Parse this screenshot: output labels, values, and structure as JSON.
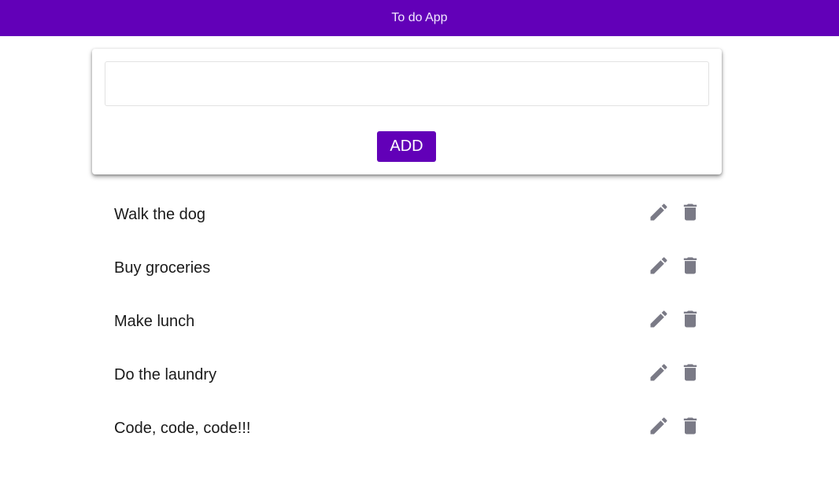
{
  "app": {
    "title": "To do App"
  },
  "form": {
    "input_value": "",
    "add_label": "ADD"
  },
  "todos": [
    {
      "text": "Walk the dog"
    },
    {
      "text": "Buy groceries"
    },
    {
      "text": "Make lunch"
    },
    {
      "text": "Do the laundry"
    },
    {
      "text": "Code, code, code!!!"
    }
  ],
  "icons": {
    "edit": "pencil-icon",
    "delete": "trash-icon"
  },
  "colors": {
    "primary": "#6200b8",
    "icon": "#7a7a86"
  }
}
